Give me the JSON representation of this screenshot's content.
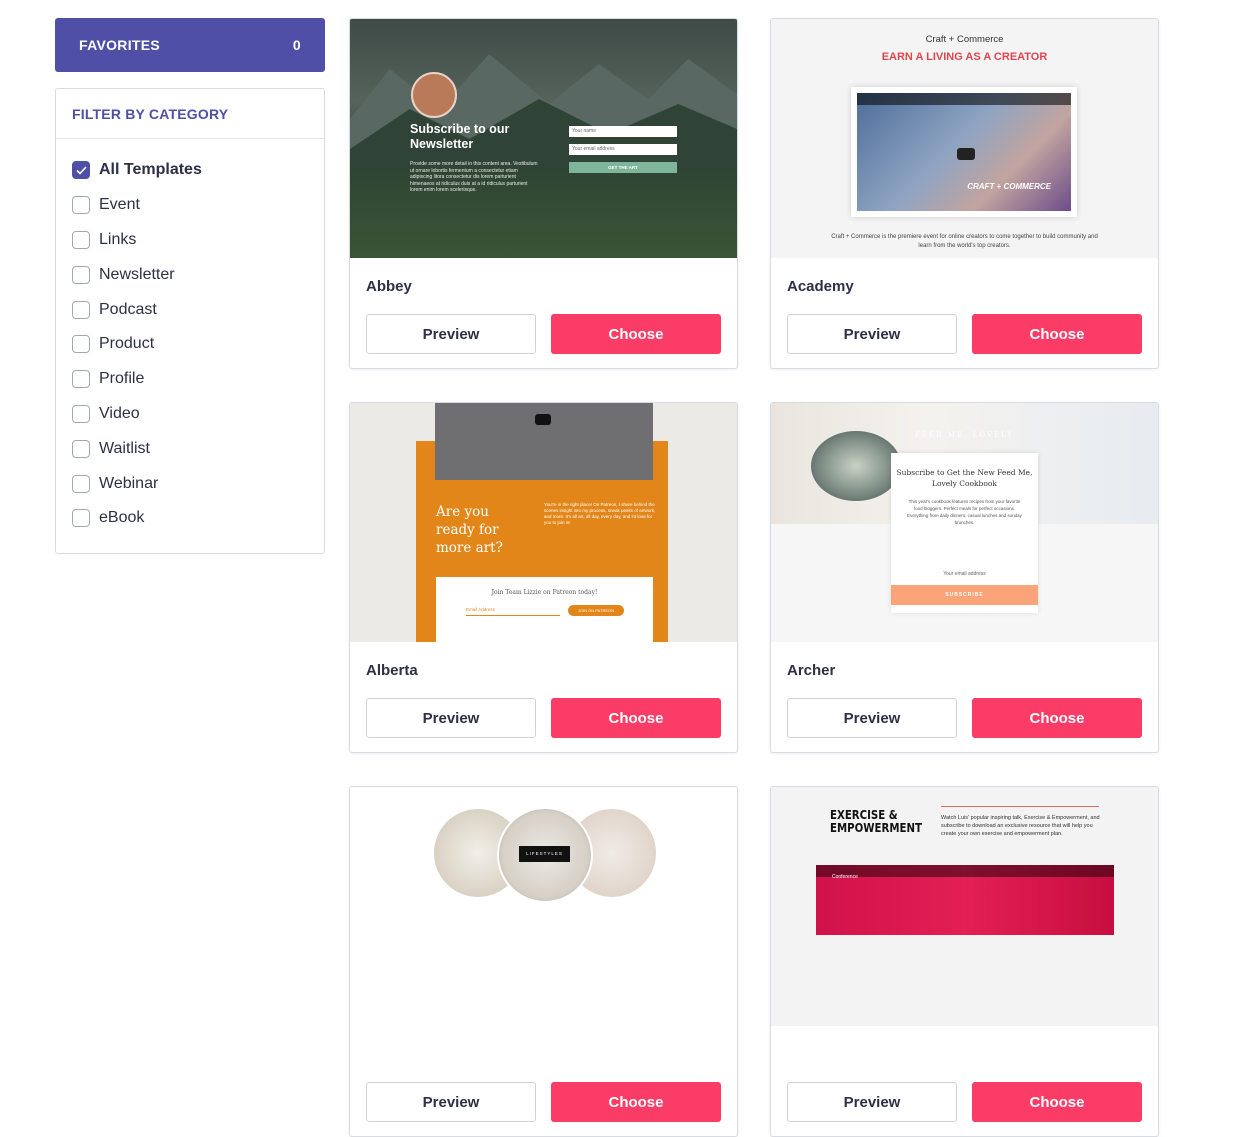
{
  "sidebar": {
    "favorites": {
      "label": "FAVORITES",
      "count": "0"
    },
    "filter": {
      "title": "FILTER BY CATEGORY",
      "categories": [
        {
          "label": "All Templates",
          "checked": true
        },
        {
          "label": "Event",
          "checked": false
        },
        {
          "label": "Links",
          "checked": false
        },
        {
          "label": "Newsletter",
          "checked": false
        },
        {
          "label": "Podcast",
          "checked": false
        },
        {
          "label": "Product",
          "checked": false
        },
        {
          "label": "Profile",
          "checked": false
        },
        {
          "label": "Video",
          "checked": false
        },
        {
          "label": "Waitlist",
          "checked": false
        },
        {
          "label": "Webinar",
          "checked": false
        },
        {
          "label": "eBook",
          "checked": false
        }
      ]
    }
  },
  "templates": [
    {
      "name": "Abbey",
      "preview_label": "Preview",
      "choose_label": "Choose",
      "thumb": {
        "heading": "Subscribe to our Newsletter",
        "body": "Provide some more detail in this content area. Vestibulum ut ornare lobortis fermentum a consectetur etiam adipiscing litora consectetur dis lorem parturient himenaeos at ridiculus duis at a id ridiculus parturient lorem enim lorem scelerisque.",
        "name_placeholder": "Your name",
        "email_placeholder": "Your email address",
        "button": "GET THE ART"
      }
    },
    {
      "name": "Academy",
      "preview_label": "Preview",
      "choose_label": "Choose",
      "thumb": {
        "kicker": "Craft + Commerce",
        "headline": "EARN A LIVING AS A CREATOR",
        "video_badge": "CRAFT + COMMERCE",
        "caption": "Craft + Commerce is the premiere event for online creators to come together to build community and learn from the world's top creators."
      }
    },
    {
      "name": "Alberta",
      "preview_label": "Preview",
      "choose_label": "Choose",
      "thumb": {
        "question": "Are you ready for more art?",
        "body": "You're in the right place! On Patreon, I share behind the scenes insight into my process, sneak peeks of artwork, and more. It's all art, all day, every day, and I'd love for you to join in!",
        "join": "Join Team Lizzie on Patreon today!",
        "email_placeholder": "Email Address",
        "button": "JOIN ON PATREON"
      }
    },
    {
      "name": "Archer",
      "preview_label": "Preview",
      "choose_label": "Choose",
      "thumb": {
        "brand": "FEED ME, LOVELY",
        "heading": "Subscribe to Get the New Feed Me, Lovely Cookbook",
        "body": "This year's cookbook features recipes from your favorite food bloggers. Perfect meals for perfect occasions. Everything from daily dinners, casual lunches and sunday brunches.",
        "email_placeholder": "Your email address",
        "button": "SUBSCRIBE"
      }
    },
    {
      "name": "",
      "preview_label": "Preview",
      "choose_label": "Choose",
      "thumb": {
        "tag": "LIFESTYLES"
      }
    },
    {
      "name": "",
      "preview_label": "Preview",
      "choose_label": "Choose",
      "thumb": {
        "heading": "EXERCISE & EMPOWERMENT",
        "body": "Watch Luis' popular inspiring talk, Exercise & Empowerment, and subscribe to download an exclusive resource that will help you create your own exercise and empowerment plan.",
        "video_title": "Conference"
      }
    }
  ],
  "colors": {
    "accent": "#4f4fa8",
    "choose": "#fb3c66"
  }
}
